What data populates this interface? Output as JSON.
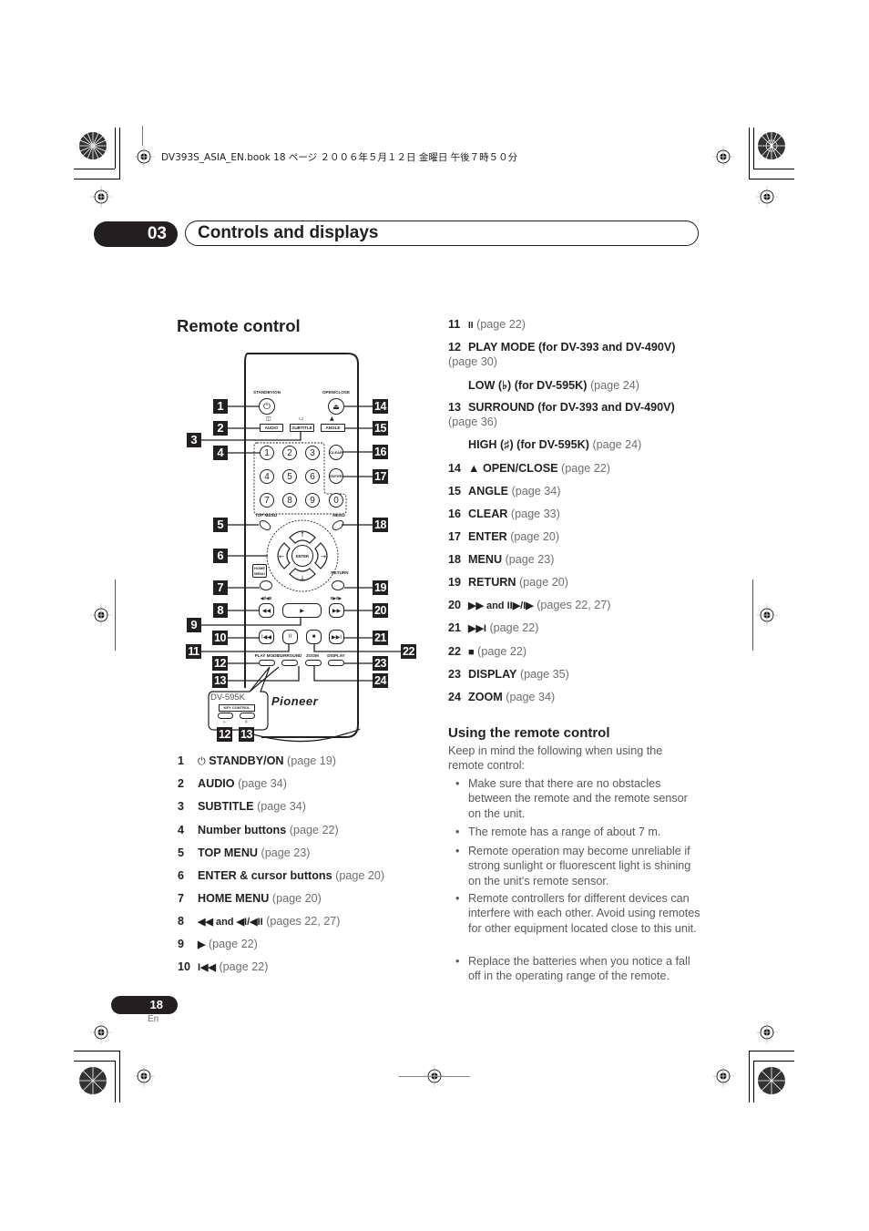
{
  "print_header": {
    "file_info": "DV393S_ASIA_EN.book  18 ページ  ２００６年５月１２日  金曜日  午後７時５０分"
  },
  "chapter": {
    "number": "03",
    "title": "Controls and displays"
  },
  "section": {
    "title": "Remote control"
  },
  "remote": {
    "brand": "Pioneer",
    "labels": {
      "standby": "STANDBY/ON",
      "open_close": "OPEN/CLOSE",
      "audio": "AUDIO",
      "subtitle": "SUBTITLE",
      "angle": "ANGLE",
      "clear": "CLEAR",
      "enter_small": "ENTER",
      "top_menu": "TOP MENU",
      "menu": "MENU",
      "enter": "ENTER",
      "home_menu": "HOME MENU",
      "return": "RETURN",
      "rew_label": "◀I/◀II",
      "fwd_label": "II▶/I▶",
      "play_mode": "PLAY MODE",
      "surround": "SURROUND",
      "zoom": "ZOOM",
      "display": "DISPLAY",
      "model_variant": "DV-595K",
      "key_control": "KEY CONTROL",
      "flat": "♭",
      "sharp": "♯"
    },
    "digits": [
      "1",
      "2",
      "3",
      "4",
      "5",
      "6",
      "7",
      "8",
      "9",
      "0"
    ],
    "callouts_left": [
      "1",
      "2",
      "3",
      "4",
      "5",
      "6",
      "7",
      "8",
      "9",
      "10",
      "11",
      "12",
      "13"
    ],
    "callouts_right": [
      "14",
      "15",
      "16",
      "17",
      "18",
      "19",
      "20",
      "21",
      "22",
      "23",
      "24"
    ],
    "callouts_bottom": [
      "12",
      "13"
    ]
  },
  "items_left": [
    {
      "num": "1",
      "icon": "⏻",
      "label": "STANDBY/ON",
      "page": "(page 19)"
    },
    {
      "num": "2",
      "label": "AUDIO",
      "page": "(page 34)"
    },
    {
      "num": "3",
      "label": "SUBTITLE",
      "page": "(page 34)"
    },
    {
      "num": "4",
      "label": "Number buttons",
      "page": "(page 22)"
    },
    {
      "num": "5",
      "label": "TOP MENU",
      "page": "(page 23)"
    },
    {
      "num": "6",
      "label": "ENTER & cursor buttons",
      "page": "(page 20)"
    },
    {
      "num": "7",
      "label": "HOME MENU",
      "page": "(page 20)"
    },
    {
      "num": "8",
      "label": "◀◀ and ◀I/◀II",
      "page": "(pages 22, 27)"
    },
    {
      "num": "9",
      "label": "▶",
      "page": "(page 22)"
    },
    {
      "num": "10",
      "label": "I◀◀",
      "page": "(page 22)"
    }
  ],
  "items_right": [
    {
      "num": "11",
      "label": "II",
      "page": "(page 22)"
    },
    {
      "num": "12",
      "label": "PLAY MODE (for DV-393 and DV-490V)",
      "page": "(page 30)"
    },
    {
      "num": "",
      "label": "LOW (♭) (for DV-595K)",
      "page": "(page 24)"
    },
    {
      "num": "13",
      "label": "SURROUND (for DV-393 and DV-490V)",
      "page": "(page 36)"
    },
    {
      "num": "",
      "label": "HIGH (♯) (for DV-595K)",
      "page": "(page 24)"
    },
    {
      "num": "14",
      "label": "▲ OPEN/CLOSE",
      "page": "(page 22)"
    },
    {
      "num": "15",
      "label": "ANGLE",
      "page": "(page 34)"
    },
    {
      "num": "16",
      "label": "CLEAR",
      "page": "(page 33)"
    },
    {
      "num": "17",
      "label": "ENTER",
      "page": "(page 20)"
    },
    {
      "num": "18",
      "label": "MENU",
      "page": "(page 23)"
    },
    {
      "num": "19",
      "label": "RETURN",
      "page": "(page 20)"
    },
    {
      "num": "20",
      "label": "▶▶ and II▶/I▶",
      "page": "(pages 22, 27)"
    },
    {
      "num": "21",
      "label": "▶▶I",
      "page": "(page 22)"
    },
    {
      "num": "22",
      "label": "■",
      "page": "(page 22)"
    },
    {
      "num": "23",
      "label": "DISPLAY",
      "page": "(page 35)"
    },
    {
      "num": "24",
      "label": "ZOOM",
      "page": "(page 34)"
    }
  ],
  "using": {
    "title": "Using the remote control",
    "intro": "Keep in mind the following when using the remote control:",
    "bullets": [
      "Make sure that there are no obstacles between the remote and the remote sensor on the unit.",
      "The remote has a range of about 7 m.",
      "Remote operation may become unreliable if strong sunlight or fluorescent light is shining on the unit's remote sensor.",
      "Remote controllers for different devices can interfere with each other. Avoid using remotes for other equipment located close to this unit.",
      "Replace the batteries when you notice a fall off in the operating range of the remote."
    ]
  },
  "footer": {
    "page_number": "18",
    "language": "En"
  }
}
